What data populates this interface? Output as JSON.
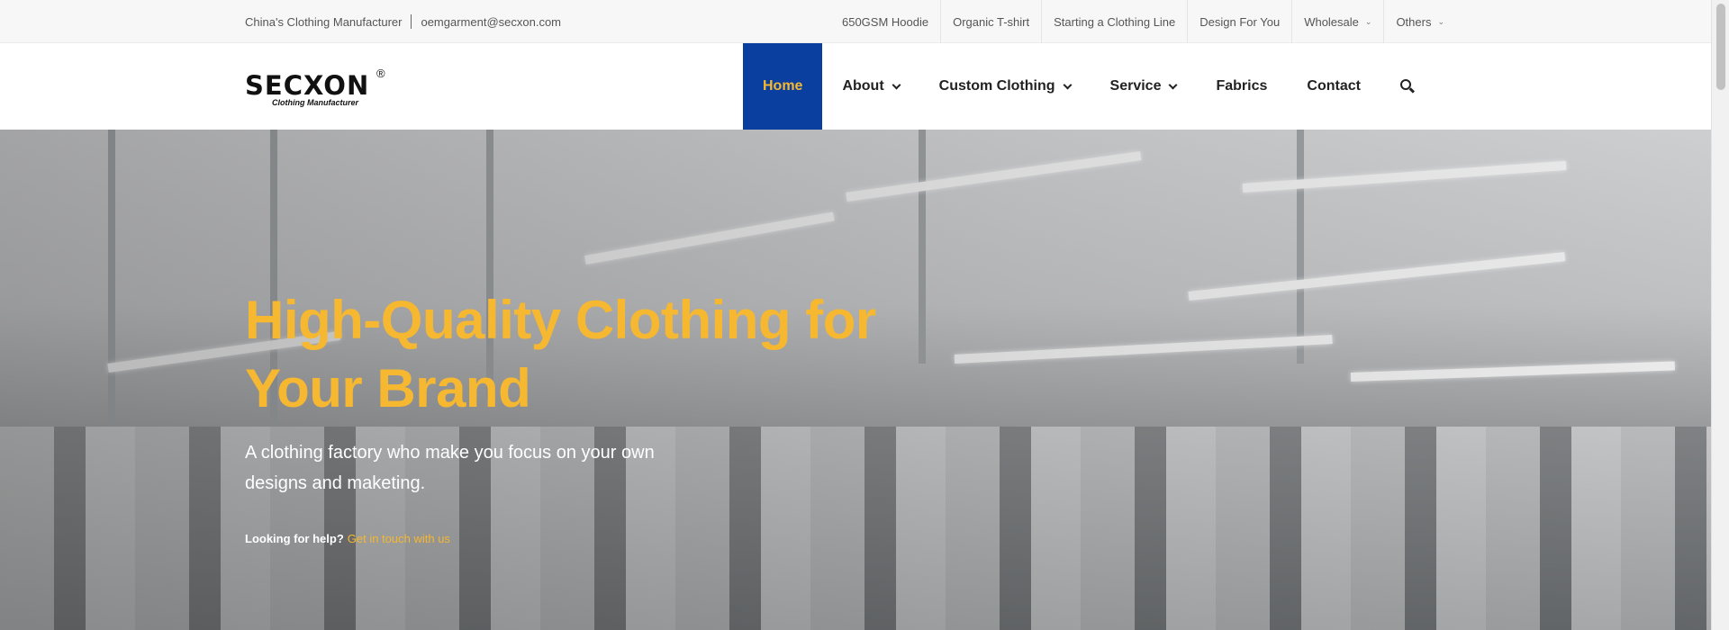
{
  "topbar": {
    "tagline": "China's Clothing Manufacturer",
    "email": "oemgarment@secxon.com",
    "links": [
      {
        "label": "650GSM Hoodie",
        "dropdown": false
      },
      {
        "label": "Organic T-shirt",
        "dropdown": false
      },
      {
        "label": "Starting a Clothing Line",
        "dropdown": false
      },
      {
        "label": "Design For You",
        "dropdown": false
      },
      {
        "label": "Wholesale",
        "dropdown": true
      },
      {
        "label": "Others",
        "dropdown": true
      }
    ]
  },
  "brand": {
    "name": "SECXON",
    "registered": "®",
    "tagline": "Clothing Manufacturer"
  },
  "nav": {
    "items": [
      {
        "label": "Home",
        "active": true,
        "dropdown": false
      },
      {
        "label": "About",
        "active": false,
        "dropdown": true
      },
      {
        "label": "Custom Clothing",
        "active": false,
        "dropdown": true
      },
      {
        "label": "Service",
        "active": false,
        "dropdown": true
      },
      {
        "label": "Fabrics",
        "active": false,
        "dropdown": false
      },
      {
        "label": "Contact",
        "active": false,
        "dropdown": false
      }
    ],
    "search_icon": "search-icon"
  },
  "hero": {
    "title": "High-Quality Clothing for Your Brand",
    "subtitle": "A clothing factory who make you focus on your own designs and maketing.",
    "help_label": "Looking for help?",
    "help_link": "Get in touch with us"
  },
  "colors": {
    "accent": "#f6b731",
    "nav_active_bg": "#0a3fa0"
  }
}
